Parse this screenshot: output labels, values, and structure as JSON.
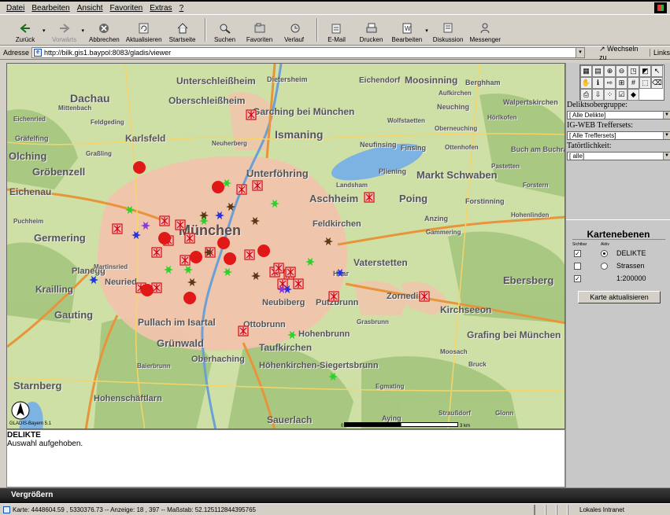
{
  "menu": [
    "Datei",
    "Bearbeiten",
    "Ansicht",
    "Favoriten",
    "Extras",
    "?"
  ],
  "toolbar": [
    {
      "label": "Zurück",
      "icon": "back-arrow-icon",
      "enabled": true,
      "dropdown": true
    },
    {
      "label": "Vorwärts",
      "icon": "forward-arrow-icon",
      "enabled": false,
      "dropdown": true
    },
    {
      "label": "Abbrechen",
      "icon": "stop-icon",
      "enabled": true
    },
    {
      "label": "Aktualisieren",
      "icon": "refresh-icon",
      "enabled": true
    },
    {
      "label": "Startseite",
      "icon": "home-icon",
      "enabled": true
    },
    {
      "label": "Suchen",
      "icon": "search-icon",
      "enabled": true
    },
    {
      "label": "Favoriten",
      "icon": "favorites-icon",
      "enabled": true
    },
    {
      "label": "Verlauf",
      "icon": "history-icon",
      "enabled": true
    },
    {
      "label": "E-Mail",
      "icon": "mail-icon",
      "enabled": true,
      "dropdown": true
    },
    {
      "label": "Drucken",
      "icon": "print-icon",
      "enabled": true
    },
    {
      "label": "Bearbeiten",
      "icon": "edit-icon",
      "enabled": true,
      "dropdown": true
    },
    {
      "label": "Diskussion",
      "icon": "discussion-icon",
      "enabled": true
    },
    {
      "label": "Messenger",
      "icon": "messenger-icon",
      "enabled": true
    }
  ],
  "address": {
    "label": "Adresse",
    "url": "http://bilk.gis1.baypol:8083/gladis/viewer",
    "go_label": "Wechseln zu",
    "links_label": "Links"
  },
  "map": {
    "places": [
      "Unterschleißheim",
      "Dietersheim",
      "Eichendorf",
      "Moosinning",
      "Berghham",
      "Aufkirchen",
      "Dachau",
      "Mittenbach",
      "Oberschleißheim",
      "Garching bei München",
      "Neuching",
      "Walpertskirchen",
      "Eichenried",
      "Feldgeding",
      "Ismaning",
      "Wolfstaetten",
      "Oberneuching",
      "Hörlkofen",
      "Gräfelfing",
      "Karlsfeld",
      "Neuherberg",
      "Neufinsing",
      "Finsing",
      "Ottenhofen",
      "Buch am Buchrain",
      "Olching",
      "Graßling",
      "Unterföhring",
      "Pliening",
      "Markt Schwaben",
      "Pastetten",
      "Gröbenzell",
      "Eichenau",
      "Landsham",
      "Aschheim",
      "Poing",
      "Forstern",
      "Forstinning",
      "Puchheim",
      "Feldkirchen",
      "Anzing",
      "Gammering",
      "Hohenlinden",
      "Germering",
      "München",
      "Vaterstetten",
      "Ebersberg",
      "Planegg",
      "Martinsried",
      "Neuried",
      "Krailling",
      "Haar",
      "Zorneding",
      "Kirchseeon",
      "Gauting",
      "Neubiberg",
      "Putzbrunn",
      "Pullach im Isartal",
      "Ottobrunn",
      "Grasbrunn",
      "Grafing bei München",
      "Grünwald",
      "Taufkirchen",
      "Hohenbrunn",
      "Oberhaching",
      "Höhenkirchen-Siegertsbrunn",
      "Baierbrunn",
      "Starnberg",
      "Hohenschäftlarn",
      "Sauerlach",
      "Egmating",
      "Aying",
      "Moosach",
      "Bruck",
      "Straußdorf",
      "Glonn"
    ],
    "scale_left": "0",
    "scale_right": "3 km",
    "copyright": "GLADIS-Bayern 5.1"
  },
  "side": {
    "delikt_label": "Deliktsobergruppe:",
    "delikt_value": "[ Alle Delikte]",
    "ig_label": "IG-WEB Treffersets:",
    "ig_value": "[ Alle Treffersets]",
    "tat_label": "Tatörtlichkeit:",
    "tat_value": "[ alle]",
    "layers_title": "Kartenebenen",
    "col_visible": "Sichtbar",
    "col_active": "Aktiv",
    "layers": [
      {
        "name": "DELIKTE",
        "visible": true,
        "radio": true,
        "active": true
      },
      {
        "name": "Strassen",
        "visible": false,
        "radio": true,
        "active": false
      },
      {
        "name": "1:200000",
        "visible": true,
        "radio": false,
        "active": false
      }
    ],
    "update_button": "Karte aktualisieren"
  },
  "info": {
    "heading": "DELIKTE",
    "line": "Auswahl aufgehoben.",
    "footer_label": "Vergrößern"
  },
  "status": {
    "text": "Karte: 4448604.59 , 5330376.73 -- Anzeige: 18 , 397 -- Maßstab: 52.125112844395765",
    "zone": "Lokales Intranet"
  }
}
